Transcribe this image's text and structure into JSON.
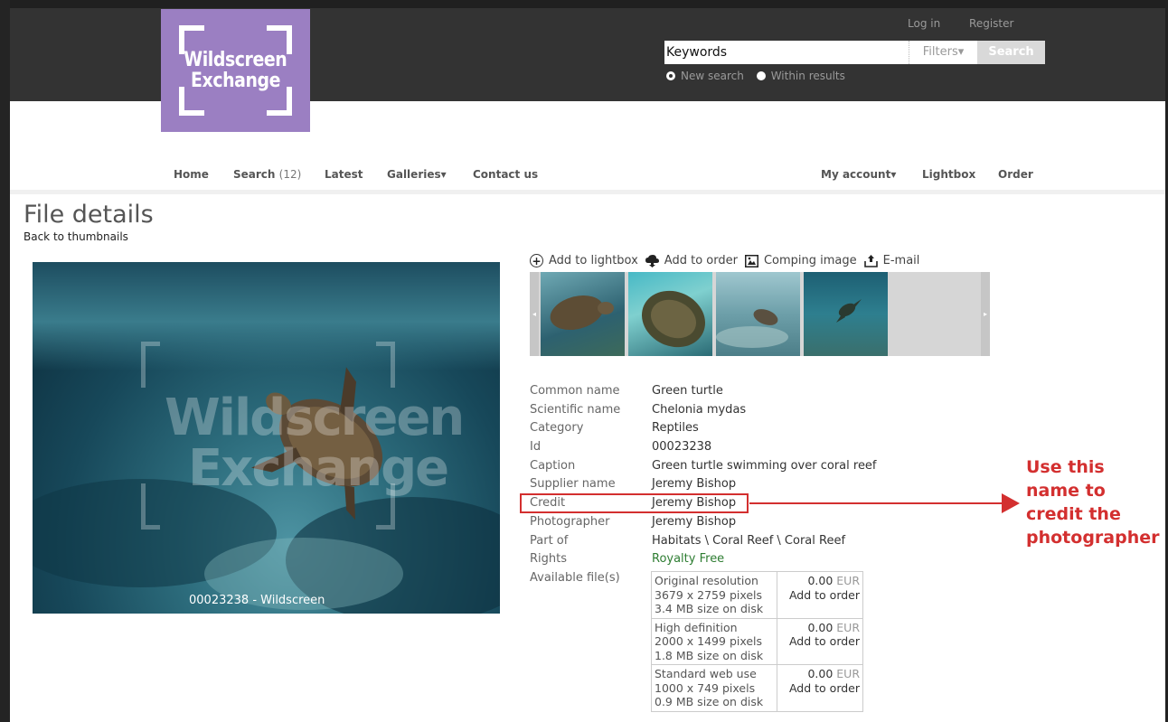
{
  "brand": {
    "logo_line1": "Wildscreen",
    "logo_line2": "Exchange",
    "logo_color": "#9b7fc2"
  },
  "top_links": {
    "login": "Log in",
    "register": "Register"
  },
  "search": {
    "value": "Keywords",
    "filters_label": "Filters▾",
    "button_label": "Search",
    "radio_new": "New search",
    "radio_within": "Within results"
  },
  "nav": {
    "home": "Home",
    "search": "Search",
    "search_count": "(12)",
    "latest": "Latest",
    "galleries": "Galleries▾",
    "contact": "Contact us",
    "my_account": "My account▾",
    "lightbox": "Lightbox",
    "order": "Order"
  },
  "page": {
    "title": "File details",
    "back_link": "Back to thumbnails"
  },
  "photo": {
    "caption_id": "00023238",
    "caption_source": "- Wildscreen",
    "watermark_line1": "Wildscreen",
    "watermark_line2": "Exchange"
  },
  "actions": {
    "add_lightbox": "Add to lightbox",
    "add_order": "Add to order",
    "comping": "Comping image",
    "email": "E-mail"
  },
  "thumbnails": {
    "icon": "turtle-photo"
  },
  "details": [
    {
      "label": "Common name",
      "value": "Green turtle"
    },
    {
      "label": "Scientific name",
      "value": "Chelonia mydas"
    },
    {
      "label": "Category",
      "value": "Reptiles"
    },
    {
      "label": "Id",
      "value": "00023238"
    },
    {
      "label": "Caption",
      "value": "Green turtle swimming over coral reef"
    },
    {
      "label": "Supplier name",
      "value": "Jeremy Bishop"
    },
    {
      "label": "Credit",
      "value": "Jeremy Bishop"
    },
    {
      "label": "Photographer",
      "value": "Jeremy Bishop"
    },
    {
      "label": "Part of",
      "value": "Habitats \\ Coral Reef \\ Coral Reef"
    },
    {
      "label": "Rights",
      "value": "Royalty Free"
    },
    {
      "label": "Available file(s)",
      "value": ""
    }
  ],
  "files": [
    {
      "name": "Original resolution",
      "dims": "3679 x 2759 pixels",
      "size": "3.4 MB size on disk",
      "price": "0.00",
      "currency": "EUR",
      "action": "Add to order"
    },
    {
      "name": "High definition",
      "dims": "2000 x 1499 pixels",
      "size": "1.8 MB size on disk",
      "price": "0.00",
      "currency": "EUR",
      "action": "Add to order"
    },
    {
      "name": "Standard web use",
      "dims": "1000 x 749 pixels",
      "size": "0.9 MB size on disk",
      "price": "0.00",
      "currency": "EUR",
      "action": "Add to order"
    }
  ],
  "annotation": {
    "line1": "Use this",
    "line2": "name to",
    "line3": "credit the",
    "line4": "photographer",
    "color": "#d32f2f"
  }
}
